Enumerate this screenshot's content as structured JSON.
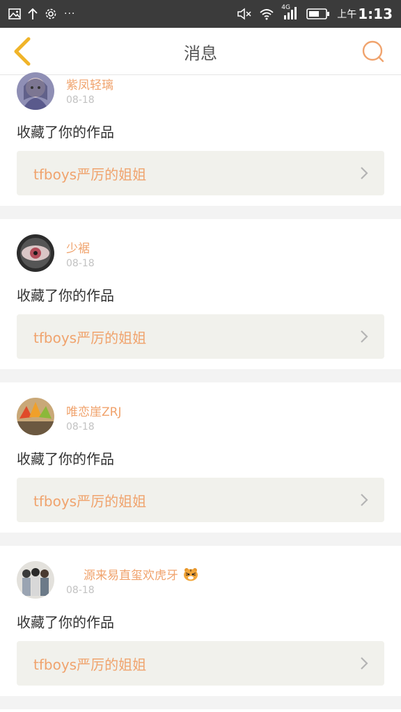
{
  "status_bar": {
    "icons_left": [
      "image-icon",
      "upload-arrow-icon",
      "settings-gear-icon"
    ],
    "more": "···",
    "network": "4G",
    "ampm": "上午",
    "time": "1:13"
  },
  "navbar": {
    "title": "消息",
    "back_icon": "chevron-left-icon",
    "search_icon": "search-icon"
  },
  "colors": {
    "accent": "#f0a36d",
    "back_arrow": "#f0b429",
    "card_bg": "#ffffff",
    "page_bg": "#f3f3f3",
    "work_box_bg": "#f1f1ec",
    "date": "#c2c2c2",
    "text": "#333333"
  },
  "messages": [
    {
      "username": "紫凤轻璃",
      "date": "08-18",
      "action": "收藏了你的作品",
      "work_title": "tfboys严厉的姐姐",
      "avatar": "avatar-girl-icon"
    },
    {
      "username": "少裾",
      "date": "08-18",
      "action": "收藏了你的作品",
      "work_title": "tfboys严厉的姐姐",
      "avatar": "avatar-eye-icon"
    },
    {
      "username": "唯恋崖ZRJ",
      "date": "08-18",
      "action": "收藏了你的作品",
      "work_title": "tfboys严厉的姐姐",
      "avatar": "avatar-leaves-icon"
    },
    {
      "username": "源来易直玺欢虎牙",
      "date": "08-18",
      "action": "收藏了你的作品",
      "work_title": "tfboys严厉的姐姐",
      "avatar": "avatar-group-icon"
    }
  ]
}
